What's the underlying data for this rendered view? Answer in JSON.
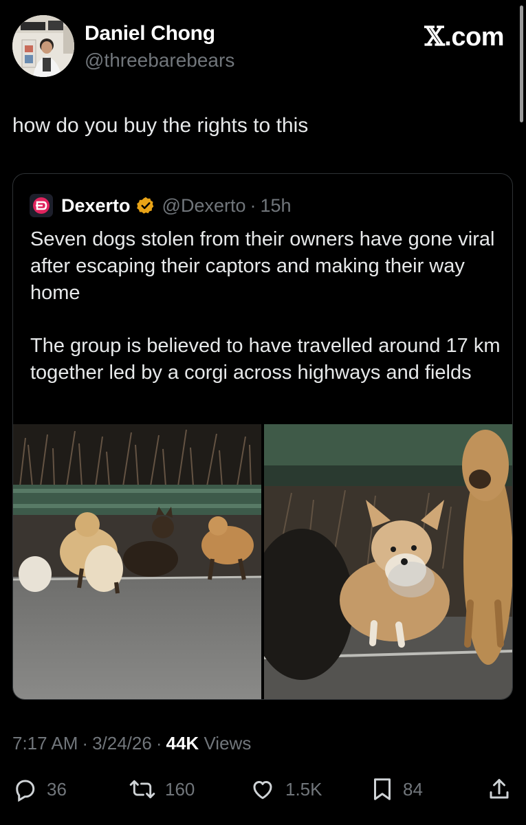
{
  "author": {
    "display_name": "Daniel Chong",
    "handle": "@threebarebears",
    "avatar_icon": "profile-photo"
  },
  "brand": {
    "label": ".com"
  },
  "tweet": {
    "text": "how do you buy the rights to this"
  },
  "quote": {
    "name": "Dexerto",
    "handle": "@Dexerto",
    "separator": "·",
    "time": "15h",
    "paragraph_1": "Seven dogs stolen from their owners have gone viral after escaping their captors and making their way home",
    "paragraph_2": "The group is believed to have travelled around 17 km together led by a corgi across highways and fields",
    "logo_color": "#e0245e",
    "verified_color": "#e8a317"
  },
  "meta": {
    "time": "7:17 AM",
    "date": "3/24/26",
    "separator": "·",
    "views_count": "44K",
    "views_label": "Views"
  },
  "actions": {
    "replies": "36",
    "reposts": "160",
    "likes": "1.5K",
    "bookmarks": "84"
  }
}
